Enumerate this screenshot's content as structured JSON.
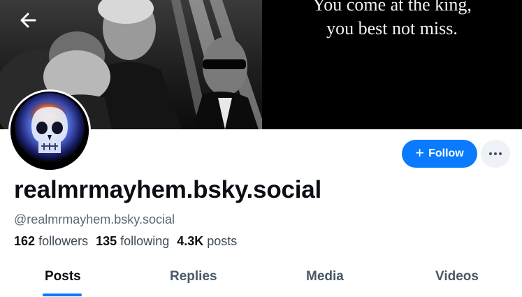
{
  "banner": {
    "quote_line_1": "You come at the king,",
    "quote_line_2": "you best not miss."
  },
  "nav": {
    "back_icon": "arrow-left-icon"
  },
  "profile": {
    "display_name": "realmrmayhem.bsky.social",
    "handle": "@realmrmayhem.bsky.social",
    "avatar_desc": "flaming-skull-avatar"
  },
  "actions": {
    "follow_label": "Follow",
    "follow_icon": "plus-icon",
    "more_icon": "ellipsis-icon"
  },
  "stats": {
    "followers_count": "162",
    "followers_label": "followers",
    "following_count": "135",
    "following_label": "following",
    "posts_count": "4.3K",
    "posts_label": "posts"
  },
  "tabs": [
    {
      "label": "Posts",
      "active": true
    },
    {
      "label": "Replies",
      "active": false
    },
    {
      "label": "Media",
      "active": false
    },
    {
      "label": "Videos",
      "active": false
    }
  ],
  "colors": {
    "accent": "#0a7aff",
    "text_primary": "#0b0f14",
    "text_secondary": "#5a6775"
  }
}
